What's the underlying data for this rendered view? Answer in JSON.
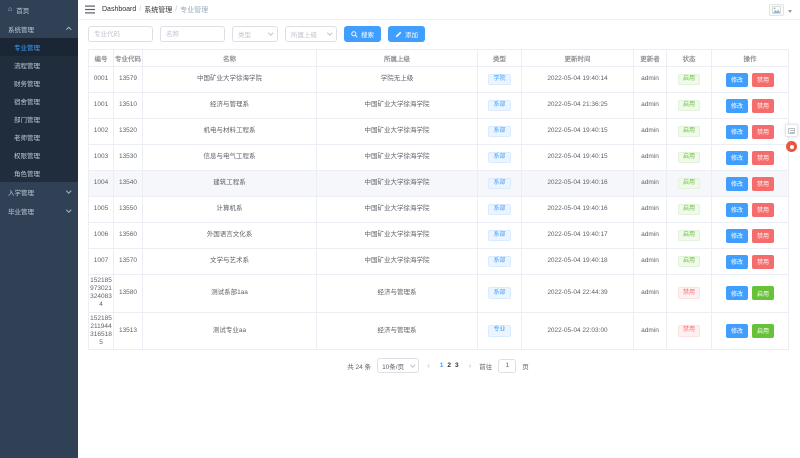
{
  "colors": {
    "primary": "#409eff",
    "sidebar_bg": "#304156",
    "submenu_bg": "#1f2d3d",
    "sidebar_text": "#bfcbd9",
    "tag_blue": "#409eff",
    "tag_green": "#67c23a",
    "tag_red": "#f56c6c",
    "float_badge_color": "#e8573f"
  },
  "sidebar": {
    "items": [
      {
        "label": "首页",
        "level": "top",
        "icon": "home-icon",
        "chevron": null,
        "active": false
      },
      {
        "label": "系统管理",
        "level": "top",
        "icon": null,
        "chevron": "up",
        "active": false
      },
      {
        "label": "专业管理",
        "level": "sub",
        "icon": null,
        "chevron": null,
        "active": true
      },
      {
        "label": "流程管理",
        "level": "sub",
        "icon": null,
        "chevron": null,
        "active": false
      },
      {
        "label": "财务管理",
        "level": "sub",
        "icon": null,
        "chevron": null,
        "active": false
      },
      {
        "label": "宿舍管理",
        "level": "sub",
        "icon": null,
        "chevron": null,
        "active": false
      },
      {
        "label": "部门管理",
        "level": "sub",
        "icon": null,
        "chevron": null,
        "active": false
      },
      {
        "label": "老师管理",
        "level": "sub",
        "icon": null,
        "chevron": null,
        "active": false
      },
      {
        "label": "权限管理",
        "level": "sub",
        "icon": null,
        "chevron": null,
        "active": false
      },
      {
        "label": "角色管理",
        "level": "sub",
        "icon": null,
        "chevron": null,
        "active": false
      },
      {
        "label": "入学管理",
        "level": "top",
        "icon": null,
        "chevron": "down",
        "active": false
      },
      {
        "label": "毕业管理",
        "level": "top",
        "icon": null,
        "chevron": "down",
        "active": false
      }
    ]
  },
  "topbar": {
    "breadcrumb": {
      "items": [
        "Dashboard",
        "系统管理",
        "专业管理"
      ],
      "separator": "/"
    }
  },
  "filters": {
    "code_placeholder": "专业代码",
    "name_placeholder": "名称",
    "type_placeholder": "类型",
    "parent_placeholder": "所属上级",
    "search_label": "搜索",
    "add_label": "添加"
  },
  "table": {
    "columns": [
      "编号",
      "专业代码",
      "名称",
      "所属上级",
      "类型",
      "更新时间",
      "更新者",
      "状态",
      "操作"
    ],
    "rows": [
      {
        "id": "0001",
        "code": "13579",
        "name": "中国矿业大学徐海学院",
        "parent": "学院无上级",
        "type": "学院",
        "time": "2022-05-04 19:40:14",
        "updater": "admin",
        "status": "启用",
        "status_kind": "green",
        "highlight": false,
        "tall": false,
        "actions": [
          {
            "label": "修改",
            "kind": "primary"
          },
          {
            "label": "禁用",
            "kind": "danger"
          }
        ]
      },
      {
        "id": "1001",
        "code": "13510",
        "name": "经济与管理系",
        "parent": "中国矿业大学徐海学院",
        "type": "系部",
        "time": "2022-05-04 21:36:25",
        "updater": "admin",
        "status": "启用",
        "status_kind": "green",
        "highlight": false,
        "tall": false,
        "actions": [
          {
            "label": "修改",
            "kind": "primary"
          },
          {
            "label": "禁用",
            "kind": "danger"
          }
        ]
      },
      {
        "id": "1002",
        "code": "13520",
        "name": "机电与材料工程系",
        "parent": "中国矿业大学徐海学院",
        "type": "系部",
        "time": "2022-05-04 19:40:15",
        "updater": "admin",
        "status": "启用",
        "status_kind": "green",
        "highlight": false,
        "tall": false,
        "actions": [
          {
            "label": "修改",
            "kind": "primary"
          },
          {
            "label": "禁用",
            "kind": "danger"
          }
        ]
      },
      {
        "id": "1003",
        "code": "13530",
        "name": "信息与电气工程系",
        "parent": "中国矿业大学徐海学院",
        "type": "系部",
        "time": "2022-05-04 19:40:15",
        "updater": "admin",
        "status": "启用",
        "status_kind": "green",
        "highlight": false,
        "tall": false,
        "actions": [
          {
            "label": "修改",
            "kind": "primary"
          },
          {
            "label": "禁用",
            "kind": "danger"
          }
        ]
      },
      {
        "id": "1004",
        "code": "13540",
        "name": "建筑工程系",
        "parent": "中国矿业大学徐海学院",
        "type": "系部",
        "time": "2022-05-04 19:40:16",
        "updater": "admin",
        "status": "启用",
        "status_kind": "green",
        "highlight": true,
        "tall": false,
        "actions": [
          {
            "label": "修改",
            "kind": "primary"
          },
          {
            "label": "禁用",
            "kind": "danger"
          }
        ]
      },
      {
        "id": "1005",
        "code": "13550",
        "name": "计算机系",
        "parent": "中国矿业大学徐海学院",
        "type": "系部",
        "time": "2022-05-04 19:40:16",
        "updater": "admin",
        "status": "启用",
        "status_kind": "green",
        "highlight": false,
        "tall": false,
        "actions": [
          {
            "label": "修改",
            "kind": "primary"
          },
          {
            "label": "禁用",
            "kind": "danger"
          }
        ]
      },
      {
        "id": "1006",
        "code": "13560",
        "name": "外国语言文化系",
        "parent": "中国矿业大学徐海学院",
        "type": "系部",
        "time": "2022-05-04 19:40:17",
        "updater": "admin",
        "status": "启用",
        "status_kind": "green",
        "highlight": false,
        "tall": false,
        "actions": [
          {
            "label": "修改",
            "kind": "primary"
          },
          {
            "label": "禁用",
            "kind": "danger"
          }
        ]
      },
      {
        "id": "1007",
        "code": "13570",
        "name": "文学与艺术系",
        "parent": "中国矿业大学徐海学院",
        "type": "系部",
        "time": "2022-05-04 19:40:18",
        "updater": "admin",
        "status": "启用",
        "status_kind": "green",
        "highlight": false,
        "tall": false,
        "actions": [
          {
            "label": "修改",
            "kind": "primary"
          },
          {
            "label": "禁用",
            "kind": "danger"
          }
        ]
      },
      {
        "id": "1521859730213240834",
        "code": "13580",
        "name": "测试系部1aa",
        "parent": "经济与管理系",
        "type": "系部",
        "time": "2022-05-04 22:44:39",
        "updater": "admin",
        "status": "禁用",
        "status_kind": "red",
        "highlight": false,
        "tall": true,
        "actions": [
          {
            "label": "修改",
            "kind": "primary"
          },
          {
            "label": "启用",
            "kind": "success"
          }
        ]
      },
      {
        "id": "1521852119443165185",
        "code": "13513",
        "name": "测试专业aa",
        "parent": "经济与管理系",
        "type": "专业",
        "time": "2022-05-04 22:03:00",
        "updater": "admin",
        "status": "禁用",
        "status_kind": "red",
        "highlight": false,
        "tall": true,
        "actions": [
          {
            "label": "修改",
            "kind": "primary"
          },
          {
            "label": "启用",
            "kind": "success"
          }
        ]
      }
    ]
  },
  "pagination": {
    "total": "共 24 条",
    "page_size": "10条/页",
    "prev": "‹",
    "next": "›",
    "pages": [
      "1",
      "2",
      "3"
    ],
    "active_page": "1",
    "goto_label": "前往",
    "goto_value": "1",
    "goto_unit": "页"
  }
}
